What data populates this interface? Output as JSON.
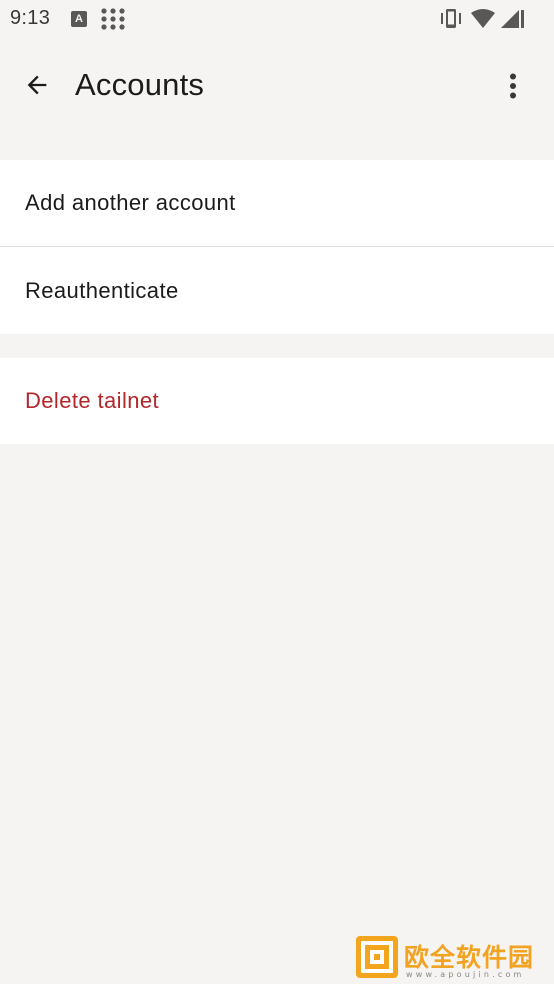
{
  "status_bar": {
    "time": "9:13",
    "notification_letter": "A",
    "icons": [
      "a-notification-icon",
      "apps-grid-icon",
      "vibrate-icon",
      "wifi-icon",
      "signal-icon",
      "battery-icon"
    ]
  },
  "app_bar": {
    "title": "Accounts",
    "back_icon": "arrow-back-icon",
    "menu_icon": "more-vert-icon"
  },
  "account_actions": [
    {
      "label": "Add another account"
    },
    {
      "label": "Reauthenticate"
    }
  ],
  "danger_actions": [
    {
      "label": "Delete tailnet"
    }
  ],
  "watermark": {
    "name": "欧全软件园",
    "url": "www.apoujin.com"
  },
  "colors": {
    "background": "#f5f4f2",
    "surface": "#ffffff",
    "danger_text": "#b3272b",
    "watermark": "#f1a321"
  }
}
